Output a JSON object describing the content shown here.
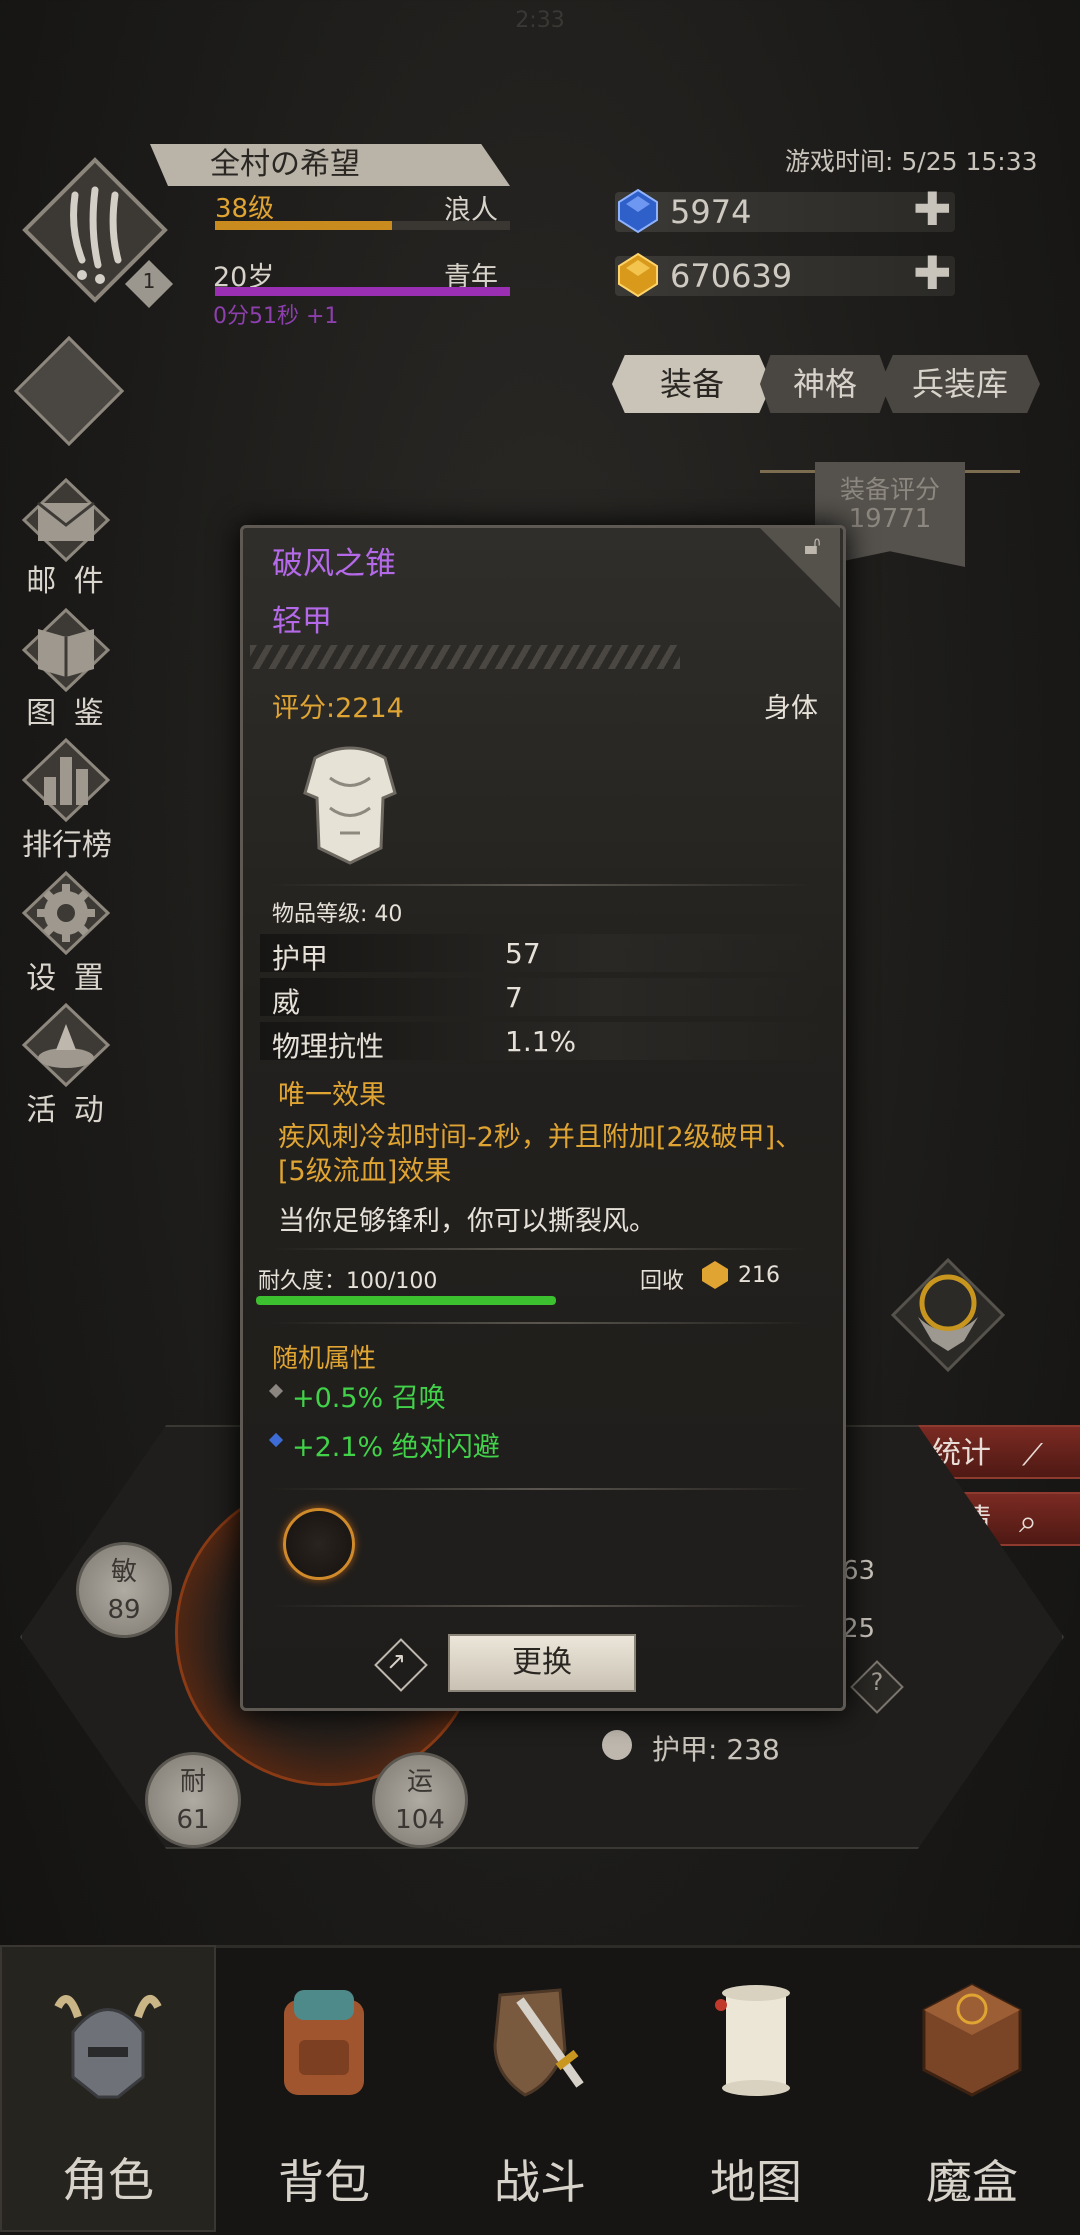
{
  "status_clock": "2:33",
  "player": {
    "name": "全村の希望",
    "level": "38级",
    "class_title": "浪人",
    "age": "20岁",
    "age_stage": "青年",
    "timer": "0分51秒 +1",
    "badge_count": "1",
    "exp_progress": 0.6,
    "age_progress": 1.0
  },
  "game_time": "游戏时间: 5/25 15:33",
  "currency": {
    "gems": "5974",
    "gold": "670639",
    "plus_symbol": "✚"
  },
  "side_menu": [
    {
      "label": "",
      "icon": "shield-slot-icon"
    },
    {
      "label": "邮 件",
      "icon": "mail-icon"
    },
    {
      "label": "图 鉴",
      "icon": "book-icon"
    },
    {
      "label": "排行榜",
      "icon": "leaderboard-icon"
    },
    {
      "label": "设 置",
      "icon": "gear-icon"
    },
    {
      "label": "活 动",
      "icon": "event-icon"
    }
  ],
  "tabs": [
    {
      "label": "装备",
      "active": true
    },
    {
      "label": "神格",
      "active": false
    },
    {
      "label": "兵装库",
      "active": false
    }
  ],
  "equip_score": {
    "label": "装备评分",
    "value": "19771"
  },
  "item": {
    "name": "破风之锥",
    "type": "轻甲",
    "score": "评分:2214",
    "slot": "身体",
    "item_level": "物品等级: 40",
    "stats": [
      {
        "name": "护甲",
        "value": "57"
      },
      {
        "name": "威",
        "value": "7"
      },
      {
        "name": "物理抗性",
        "value": "1.1%"
      }
    ],
    "unique_title": "唯一效果",
    "unique_desc": "疾风刺冷却时间-2秒，并且附加[2级破甲]、[5级流血]效果",
    "flavor": "当你足够锋利，你可以撕裂风。",
    "durability": "耐久度：100/100",
    "durability_progress": 1.0,
    "recycle_label": "回收",
    "recycle_value": "216",
    "random_title": "随机属性",
    "random_stats": [
      "+0.5% 召唤",
      "+2.1% 绝对闪避"
    ],
    "replace_button": "更换"
  },
  "right_buttons": {
    "stats": "统计",
    "details": "详情"
  },
  "attributes": {
    "agility": {
      "name": "敏",
      "value": "89"
    },
    "stamina": {
      "name": "耐",
      "value": "61"
    },
    "luck": {
      "name": "运",
      "value": "104"
    },
    "partial_1": "63",
    "partial_2": "25",
    "armor": "护甲: 238"
  },
  "bottom_nav": [
    {
      "label": "角色",
      "icon": "helmet-icon",
      "active": true
    },
    {
      "label": "背包",
      "icon": "backpack-icon",
      "active": false
    },
    {
      "label": "战斗",
      "icon": "sword-shield-icon",
      "active": false
    },
    {
      "label": "地图",
      "icon": "scroll-map-icon",
      "active": false
    },
    {
      "label": "魔盒",
      "icon": "magic-box-icon",
      "active": false
    }
  ],
  "colors": {
    "purple_name": "#b469e8",
    "gold_text": "#e0a432",
    "green_text": "#41d24a"
  }
}
